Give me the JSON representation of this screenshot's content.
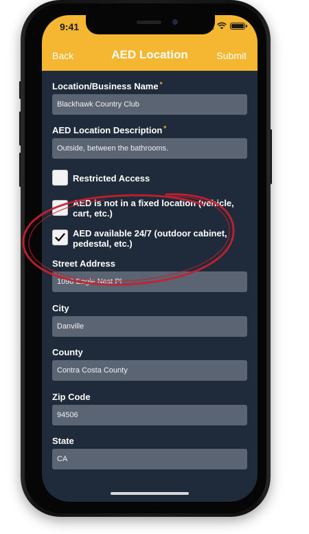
{
  "status_bar": {
    "time": "9:41"
  },
  "nav": {
    "back": "Back",
    "title": "AED Location",
    "submit": "Submit"
  },
  "form": {
    "location_name": {
      "label": "Location/Business Name",
      "required_mark": "*",
      "value": "Blackhawk Country Club"
    },
    "description": {
      "label": "AED Location Description",
      "required_mark": "*",
      "value": "Outside, between the bathrooms."
    },
    "checkboxes": [
      {
        "label": "Restricted Access",
        "checked": false
      },
      {
        "label": "AED is not in a fixed location (vehicle, cart, etc.)",
        "checked": false
      },
      {
        "label": "AED available 24/7 (outdoor cabinet, pedestal, etc.)",
        "checked": true
      }
    ],
    "street": {
      "label": "Street Address",
      "value": "1098 Eagle Nest Pl"
    },
    "city": {
      "label": "City",
      "value": "Danville"
    },
    "county": {
      "label": "County",
      "value": "Contra Costa County"
    },
    "zip": {
      "label": "Zip Code",
      "value": "94506"
    },
    "state": {
      "label": "State",
      "value": "CA"
    }
  },
  "colors": {
    "accent": "#f5b731",
    "background": "#1f2b3a",
    "field": "#5a6472",
    "annotation": "#c8202e"
  }
}
